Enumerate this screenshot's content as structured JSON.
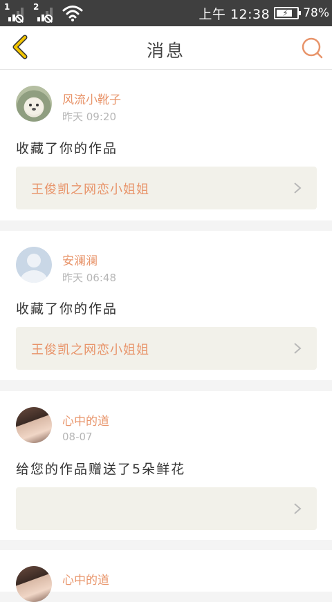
{
  "status_bar": {
    "sim1_label": "1",
    "sim2_label": "2",
    "time": "上午 12:38",
    "battery_percent": "78%",
    "battery_level": 0.78,
    "signal_icon": "signal-bars-icon",
    "wifi_icon": "wifi-icon",
    "battery_icon": "battery-charging-icon"
  },
  "header": {
    "title": "消息",
    "back_icon": "chevron-left-icon",
    "search_icon": "search-icon"
  },
  "colors": {
    "accent": "#e8946a",
    "back_arrow": "#e8b800",
    "status_bar_bg": "#3f3f3f",
    "link_bg": "#f2f1ea",
    "page_bg": "#f4f4f4"
  },
  "messages": [
    {
      "user": "风流小靴子",
      "time": "昨天 09:20",
      "action": "收藏了你的作品",
      "work_title": "王俊凯之网恋小姐姐",
      "avatar": "hedgehog-avatar"
    },
    {
      "user": "安澜澜",
      "time": "昨天 06:48",
      "action": "收藏了你的作品",
      "work_title": "王俊凯之网恋小姐姐",
      "avatar": "default-avatar"
    },
    {
      "user": "心中的道",
      "time": "08-07",
      "action": "给您的作品赠送了5朵鲜花",
      "work_title": "",
      "avatar": "girl-avatar"
    },
    {
      "user": "心中的道",
      "avatar": "girl-avatar"
    }
  ]
}
